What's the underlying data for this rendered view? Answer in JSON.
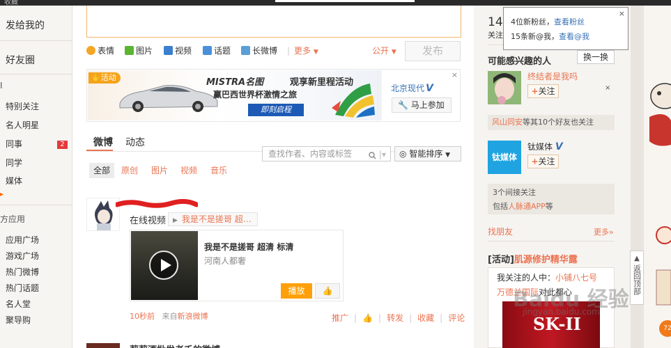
{
  "topbar": {
    "text": "收藏"
  },
  "leftnav": {
    "mentions": "发给我的",
    "friends_circle": "好友圈",
    "group_marker": "I",
    "groups": [
      {
        "label": "特别关注"
      },
      {
        "label": "名人明星"
      },
      {
        "label": "同事",
        "badge": "2"
      },
      {
        "label": "同学"
      },
      {
        "label": "媒体"
      }
    ],
    "apps_section": "方应用",
    "apps": [
      "应用广场",
      "游戏广场",
      "热门微博",
      "热门话题",
      "名人堂",
      "聚导购"
    ]
  },
  "composer": {
    "tools": [
      {
        "label": "表情",
        "icon": "smile-icon",
        "color": "#f5a623"
      },
      {
        "label": "图片",
        "icon": "image-icon",
        "color": "#5cb531"
      },
      {
        "label": "视频",
        "icon": "video-icon",
        "color": "#3c7fcf"
      },
      {
        "label": "话题",
        "icon": "topic-icon",
        "color": "#4a90d9"
      },
      {
        "label": "长微博",
        "icon": "long-post-icon",
        "color": "#5a9fd6"
      }
    ],
    "more": "更多",
    "visibility": "公开",
    "publish": "发布"
  },
  "ad": {
    "tag": "活动",
    "brand": "MISTRA名图",
    "line1": "观享新里程活动",
    "line2": "赢巴西世界杯激情之旅",
    "button": "即刻启程",
    "advertiser": "北京现代",
    "verified": "V",
    "join": "马上参加",
    "close": "×"
  },
  "feed_tabs": {
    "main": "微博",
    "dynamic": "动态",
    "search_placeholder": "查找作者、内容或标签",
    "sort": "智能排序",
    "filters": [
      "全部",
      "原创",
      "图片",
      "视频",
      "音乐"
    ]
  },
  "post": {
    "source_label": "在线视频",
    "source_title": "我是不是搓哥 超…",
    "card_title": "我是不是搓哥 超清 标清",
    "card_sub": "河南人都奢",
    "card_play": "播放",
    "time": "10秒前",
    "from_prefix": "来自",
    "from_link": "新浪微博",
    "actions": [
      "推广",
      "转发",
      "收藏",
      "评论"
    ]
  },
  "next_post": {
    "title": "莉莉酒批发老壬的微博"
  },
  "popup": {
    "line1_prefix": "4位新粉丝，",
    "line1_link": "查看粉丝",
    "line2_prefix": "15条新@我，",
    "line2_link": "查看@我",
    "close": "×"
  },
  "sidebar": {
    "follow_count": "14",
    "follow_label": "关注",
    "interested_title": "可能感兴趣的人",
    "swap": "换一换",
    "person1_name": "终结者是我吗",
    "follow_btn": "关注",
    "remove": "×",
    "mutual_link": "风山同安",
    "mutual_text": "等其10个好友也关注",
    "person2_name": "钛媒体",
    "person2_avatar": "钛媒体",
    "verified": "V",
    "indirect_line1": "3个间接关注",
    "indirect_prefix": "包括",
    "indirect_link": "人脉通APP",
    "indirect_suffix": "等",
    "find_friends": "找朋友",
    "more": "更多»",
    "activity_tag": "[活动]",
    "activity_name": "肌源修护精华露",
    "activity_line1_prefix": "我关注的人中：",
    "activity_line1_link": "小铺八七号",
    "activity_line2_link": "万德兰国际",
    "activity_line2_suffix": "对此都心",
    "product": "SK-II"
  },
  "backtop": {
    "label": "返回顶部"
  },
  "edge": {
    "badge": "72"
  },
  "watermark": {
    "main": "Baidu 经验",
    "sub": "jingyan.baidu.com"
  }
}
